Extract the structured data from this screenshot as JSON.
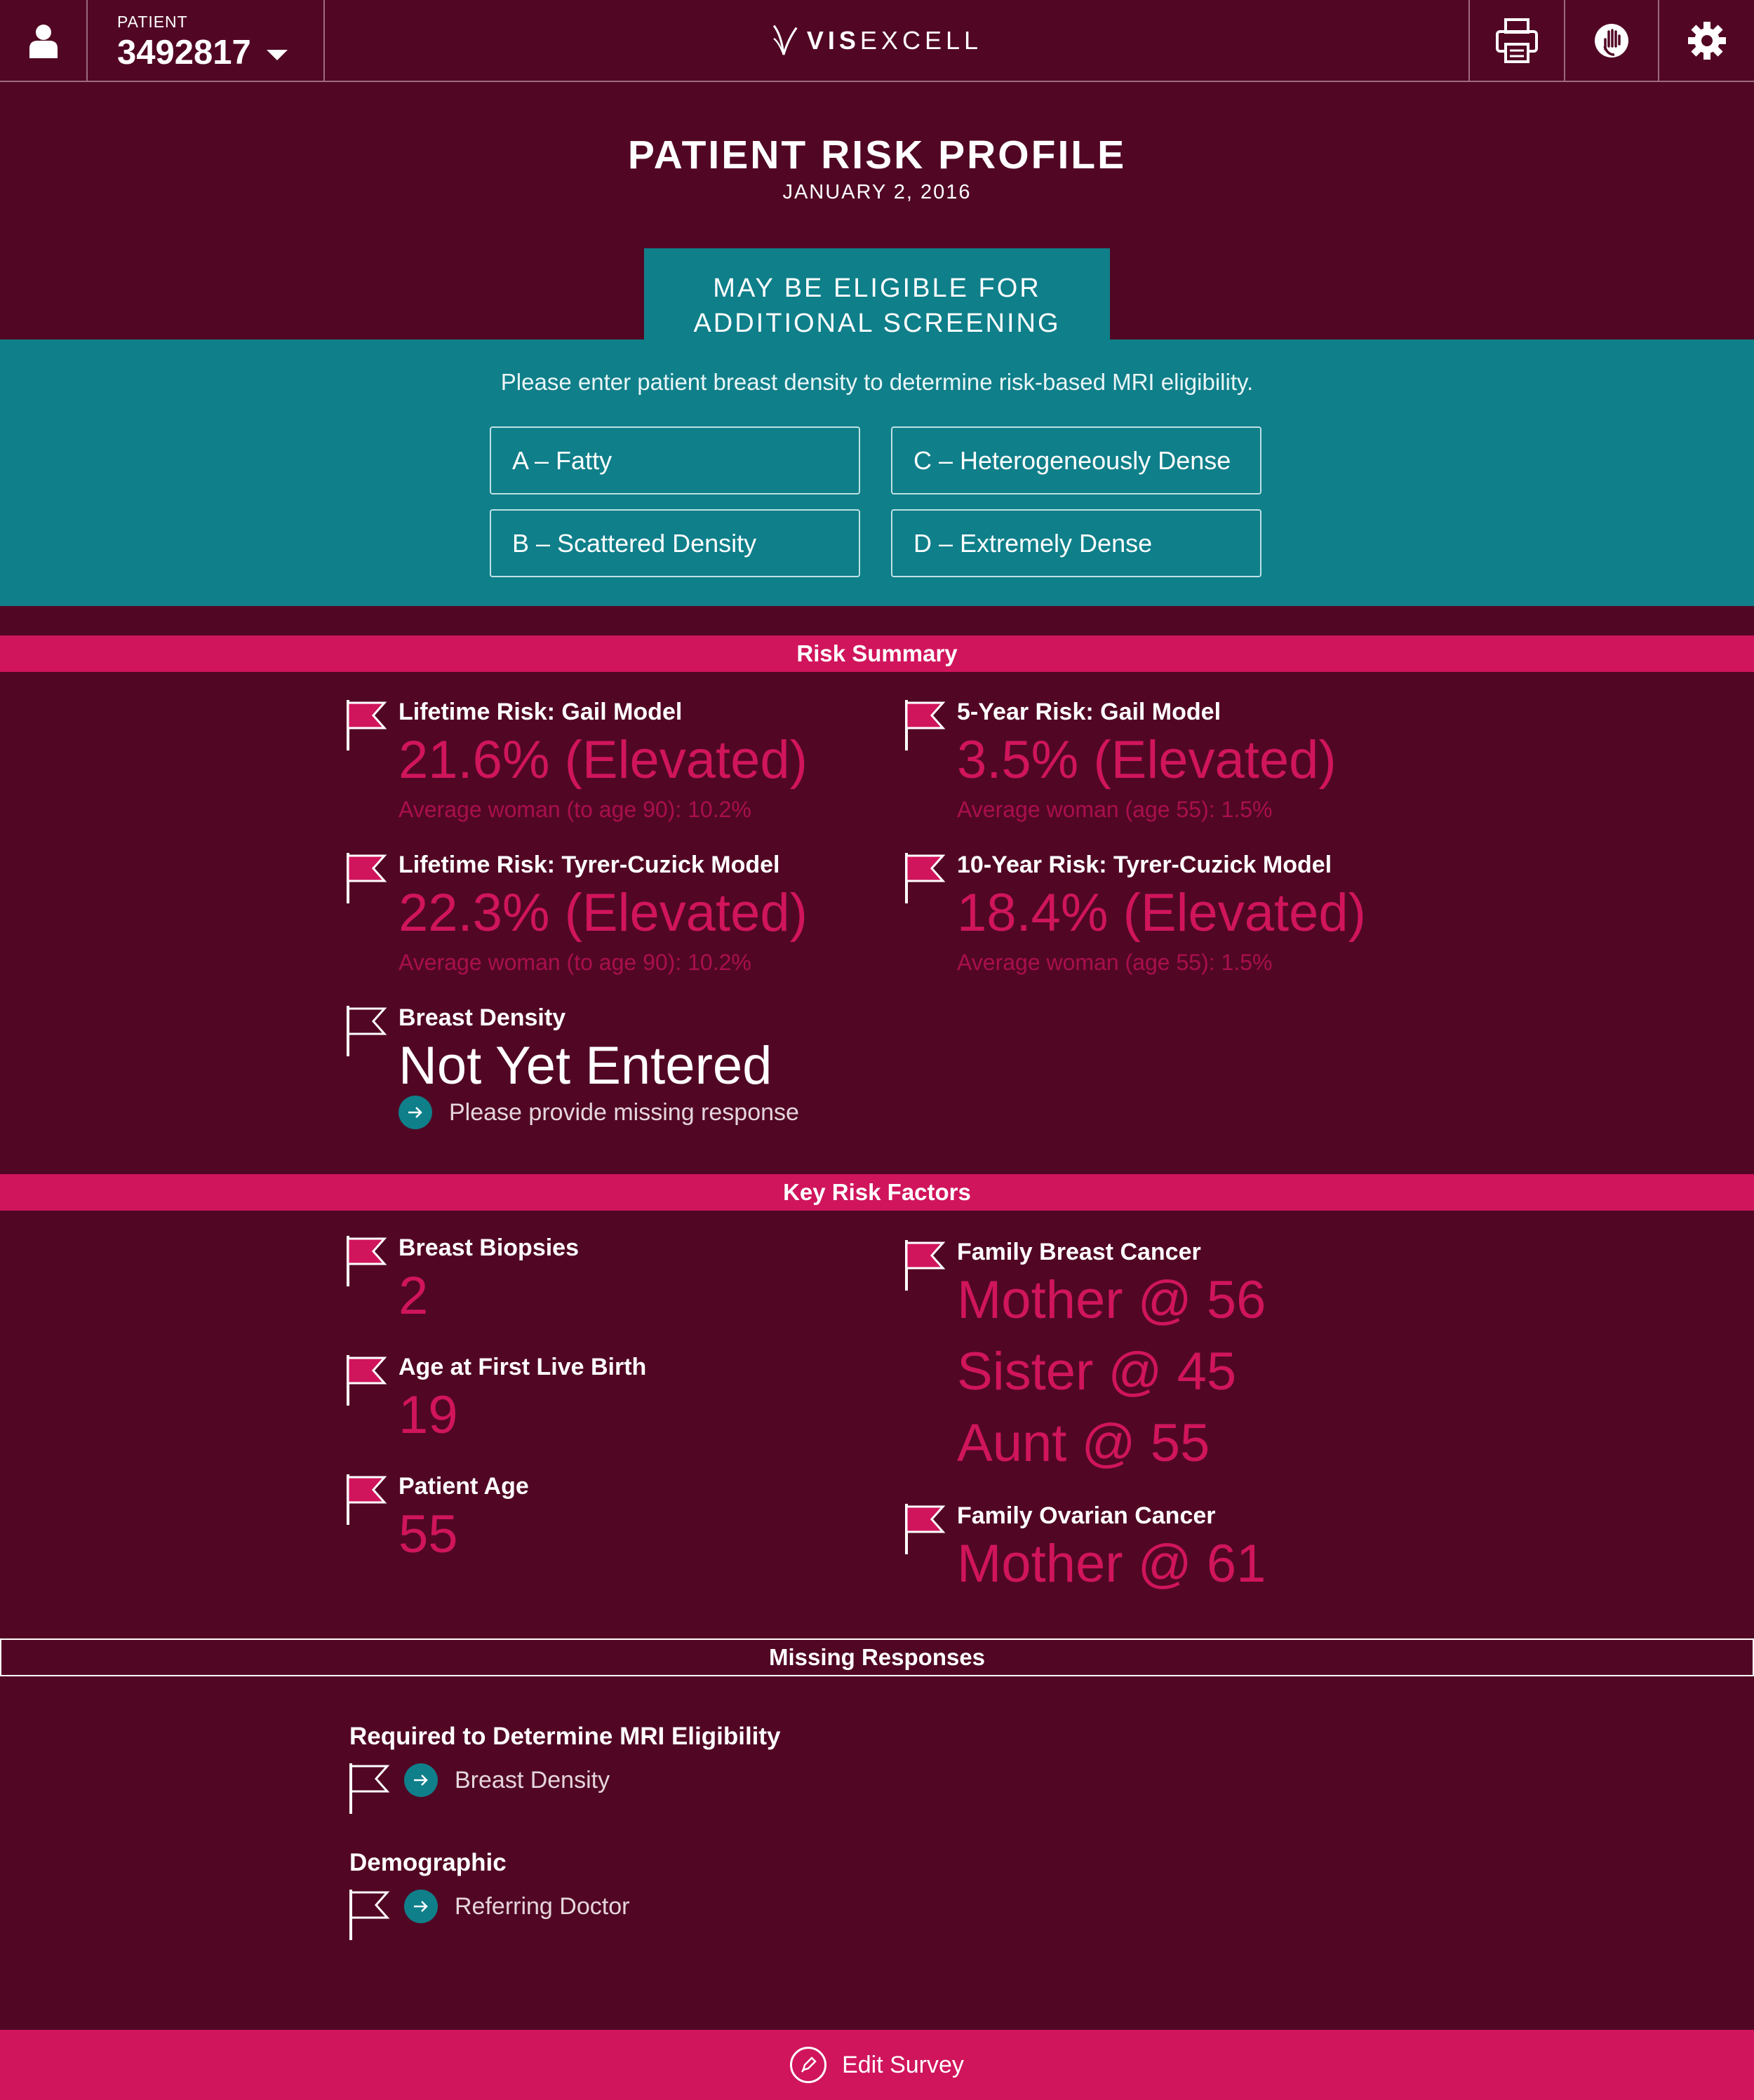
{
  "header": {
    "patient_label": "PATIENT",
    "patient_id": "3492817",
    "logo_bold": "VIS",
    "logo_rest": "EXCELL",
    "icons": [
      "user-icon",
      "caret-down-icon",
      "printer-icon",
      "hand-icon",
      "gear-icon"
    ]
  },
  "page": {
    "title": "PATIENT RISK PROFILE",
    "date": "JANUARY 2, 2016"
  },
  "eligibility": {
    "line1": "MAY BE ELIGIBLE FOR",
    "line2": "ADDITIONAL SCREENING",
    "prompt": "Please enter patient breast density to determine risk-based MRI eligibility.",
    "options": [
      "A – Fatty",
      "C – Heterogeneously Dense",
      "B – Scattered Density",
      "D – Extremely Dense"
    ]
  },
  "risk_summary": {
    "heading": "Risk Summary",
    "items": [
      {
        "label": "Lifetime Risk: Gail Model",
        "value": "21.6% (Elevated)",
        "avg": "Average woman (to age 90): 10.2%"
      },
      {
        "label": "5-Year Risk: Gail Model",
        "value": "3.5% (Elevated)",
        "avg": "Average woman (age 55): 1.5%"
      },
      {
        "label": "Lifetime Risk: Tyrer-Cuzick Model",
        "value": "22.3% (Elevated)",
        "avg": "Average woman (to age 90): 10.2%"
      },
      {
        "label": "10-Year Risk: Tyrer-Cuzick Model",
        "value": "18.4% (Elevated)",
        "avg": "Average woman (age 55): 1.5%"
      }
    ],
    "density": {
      "label": "Breast Density",
      "value": "Not Yet Entered",
      "link": "Please provide missing response"
    }
  },
  "key_factors": {
    "heading": "Key Risk Factors",
    "biopsies": {
      "label": "Breast Biopsies",
      "value": "2"
    },
    "first_birth": {
      "label": "Age at First Live Birth",
      "value": "19"
    },
    "age": {
      "label": "Patient Age",
      "value": "55"
    },
    "family_breast": {
      "label": "Family Breast Cancer",
      "values": [
        "Mother @ 56",
        "Sister @ 45",
        "Aunt @ 55"
      ]
    },
    "family_ovarian": {
      "label": "Family Ovarian Cancer",
      "value": "Mother @ 61"
    }
  },
  "missing": {
    "heading": "Missing Responses",
    "groups": [
      {
        "label": "Required to Determine MRI Eligibility",
        "item": "Breast Density"
      },
      {
        "label": "Demographic",
        "item": "Referring Doctor"
      }
    ]
  },
  "footer": {
    "label": "Edit Survey"
  },
  "colors": {
    "background": "#510724",
    "accent": "#d0155c",
    "teal": "#0f7f8a"
  }
}
